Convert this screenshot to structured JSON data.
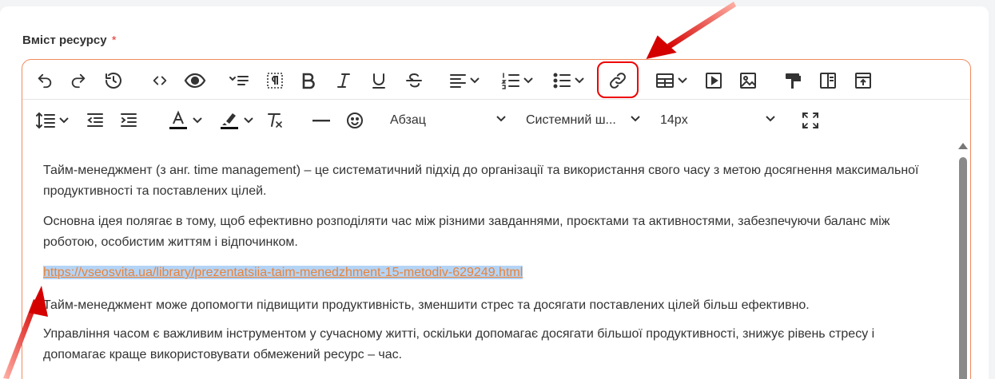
{
  "field": {
    "label": "Вміст ресурсу",
    "required_mark": "*"
  },
  "toolbar": {
    "row1": [
      "undo-icon",
      "redo-icon",
      "history-icon",
      "source-code-icon",
      "preview-icon",
      "template-icon",
      "show-blocks-icon",
      "bold-icon",
      "italic-icon",
      "underline-icon",
      "strikethrough-icon",
      "align-icon",
      "numbered-list-icon",
      "bullet-list-icon",
      "link-icon",
      "table-icon",
      "media-icon",
      "image-icon",
      "format-painter-icon",
      "columns-icon",
      "upload-icon"
    ],
    "row2": [
      "line-height-icon",
      "outdent-icon",
      "indent-icon",
      "text-color-icon",
      "highlight-icon",
      "clear-format-icon",
      "horizontal-line-icon",
      "emoji-icon",
      "fullscreen-icon"
    ],
    "block_format": "Абзац",
    "font_family": "Системний ш...",
    "font_size": "14px"
  },
  "content": {
    "p1": "Тайм-менеджмент (з анг. time management) – це систематичний підхід до організації та використання свого часу з метою досягнення максимальної продуктивності та поставлених цілей.",
    "p2": "Основна ідея полягає в тому, щоб ефективно розподіляти час між різними завданнями, проєктами та активностями, забезпечуючи баланс між роботою, особистим життям і відпочинком.",
    "url": "https://vseosvita.ua/library/prezentatsiia-taim-menedzhment-15-metodiv-629249.html",
    "p4": "Тайм-менеджмент може допомогти підвищити продуктивність, зменшити стрес та досягати поставлених цілей більш ефективно.",
    "p5": "Управління часом є важливим інструментом у сучасному житті, оскільки допомагає досягати більшої продуктивності, знижує рівень стресу і допомагає краще використовувати обмежений ресурс – час."
  },
  "colors": {
    "accent": "#f08a5d",
    "highlight_box": "#ee0000",
    "link": "#e8833a",
    "selection": "#b4d4f6"
  }
}
